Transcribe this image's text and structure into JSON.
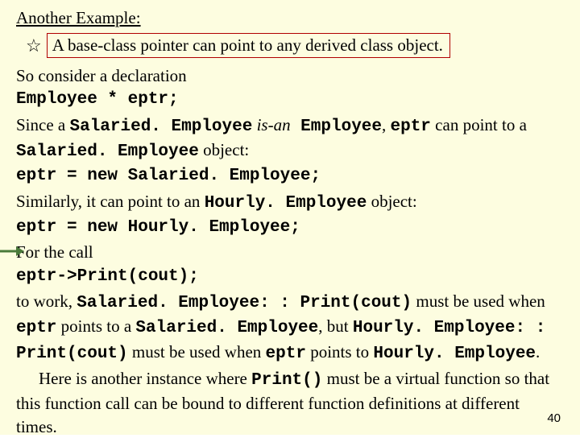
{
  "title": "Another Example:",
  "boxed_rule": "A base-class pointer can point to any derived class object.",
  "star_glyph": "☆",
  "lines": {
    "l1a": "So consider a declaration",
    "l1b": "Employee * eptr;",
    "l2a": "Since a ",
    "l2b": "Salaried. Employee",
    "l2c": " is-an",
    "l2d": " Employee",
    "l2e": ", ",
    "l2f": "eptr",
    "l2g": " can point to a ",
    "l2h": "Salaried. Employee",
    "l2i": " object:",
    "l2j": "eptr = new Salaried. Employee;",
    "l3a": "Similarly, it can point to an ",
    "l3b": "Hourly. Employee",
    "l3c": " object:",
    "l3d": "eptr = new Hourly. Employee;",
    "l4a": "For the call",
    "l4b": "eptr->Print(cout);",
    "l5a": "to work, ",
    "l5b": "Salaried. Employee: : Print(cout)",
    "l5c": " must be used when ",
    "l5d": "eptr",
    "l5e": " points to a ",
    "l5f": "Salaried. Employee",
    "l5g": ", but ",
    "l5h": "Hourly. Employee: : Print(cout)",
    "l5i": " must be used when ",
    "l5j": "eptr",
    "l5k": " points to ",
    "l5l": "Hourly. Employee",
    "l5m": ".",
    "l6a": "Here is another instance where ",
    "l6b": "Print()",
    "l6c": " must be a virtual function so that this function call can be bound to different function definitions at different times."
  },
  "page_number": "40"
}
